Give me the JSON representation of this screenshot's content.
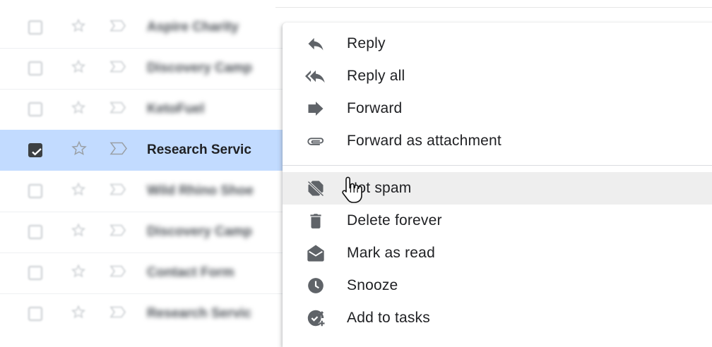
{
  "email_list": {
    "rows": [
      {
        "sender": "Aspire Charity",
        "selected": false
      },
      {
        "sender": "Discovery Camp",
        "selected": false
      },
      {
        "sender": "KetoFuel",
        "selected": false
      },
      {
        "sender": "Research Servic",
        "selected": true
      },
      {
        "sender": "Wild Rhino Shoe",
        "selected": false
      },
      {
        "sender": "Discovery Camp",
        "selected": false
      },
      {
        "sender": "Contact Form",
        "selected": false
      },
      {
        "sender": "Research Servic",
        "selected": false
      }
    ]
  },
  "context_menu": {
    "items": [
      {
        "label": "Reply",
        "icon": "reply-icon"
      },
      {
        "label": "Reply all",
        "icon": "reply-all-icon"
      },
      {
        "label": "Forward",
        "icon": "forward-icon"
      },
      {
        "label": "Forward as attachment",
        "icon": "attachment-icon"
      },
      {
        "label": "Not spam",
        "icon": "not-spam-icon",
        "hovered": true
      },
      {
        "label": "Delete forever",
        "icon": "trash-icon"
      },
      {
        "label": "Mark as read",
        "icon": "open-envelope-icon"
      },
      {
        "label": "Snooze",
        "icon": "clock-icon"
      },
      {
        "label": "Add to tasks",
        "icon": "add-task-icon"
      }
    ]
  },
  "colors": {
    "selected_row": "#c2dbff",
    "menu_hover": "#eeeeee",
    "icon": "#5f6368",
    "text": "#202124"
  }
}
